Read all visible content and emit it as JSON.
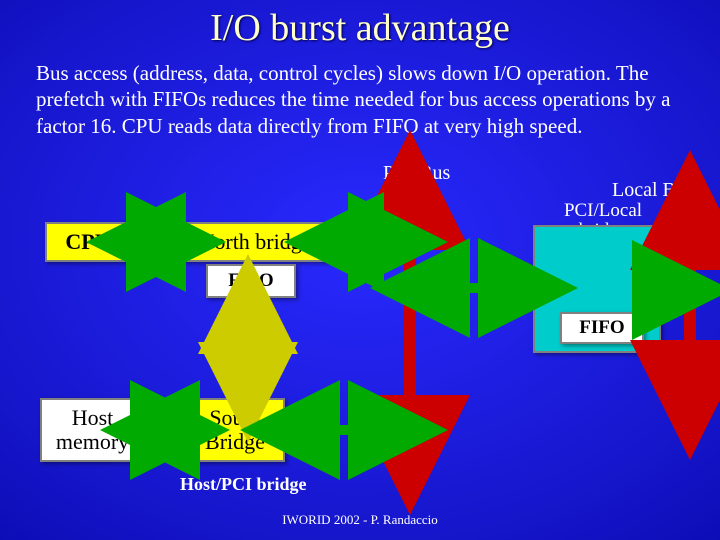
{
  "title": "I/O burst advantage",
  "body_text": "Bus access (address, data, control cycles) slows down I/O operation. The prefetch with FIFOs reduces the time needed for bus access operations by a factor 16. CPU reads data directly from FIFO at very high speed.",
  "labels": {
    "pci_bus": "PCI Bus",
    "local_bus": "Local Bus",
    "pci_local_bridge": "PCI/Local bridge",
    "host_pci_bridge": "Host/PCI bridge"
  },
  "boxes": {
    "cpu": "CPU",
    "north_bridge": "North bridge",
    "south_bridge": "South Bridge",
    "host_memory": "Host memory",
    "fifo1": "FIFO",
    "fifo2": "FIFO"
  },
  "footer": "IWORID 2002 - P. Randaccio",
  "colors": {
    "yellow": "#ffff00",
    "white": "#ffffff",
    "cyan": "#00cccc",
    "green_arrow": "#00aa00",
    "red_arrow": "#cc0000",
    "yellow_arrow": "#cccc00"
  }
}
